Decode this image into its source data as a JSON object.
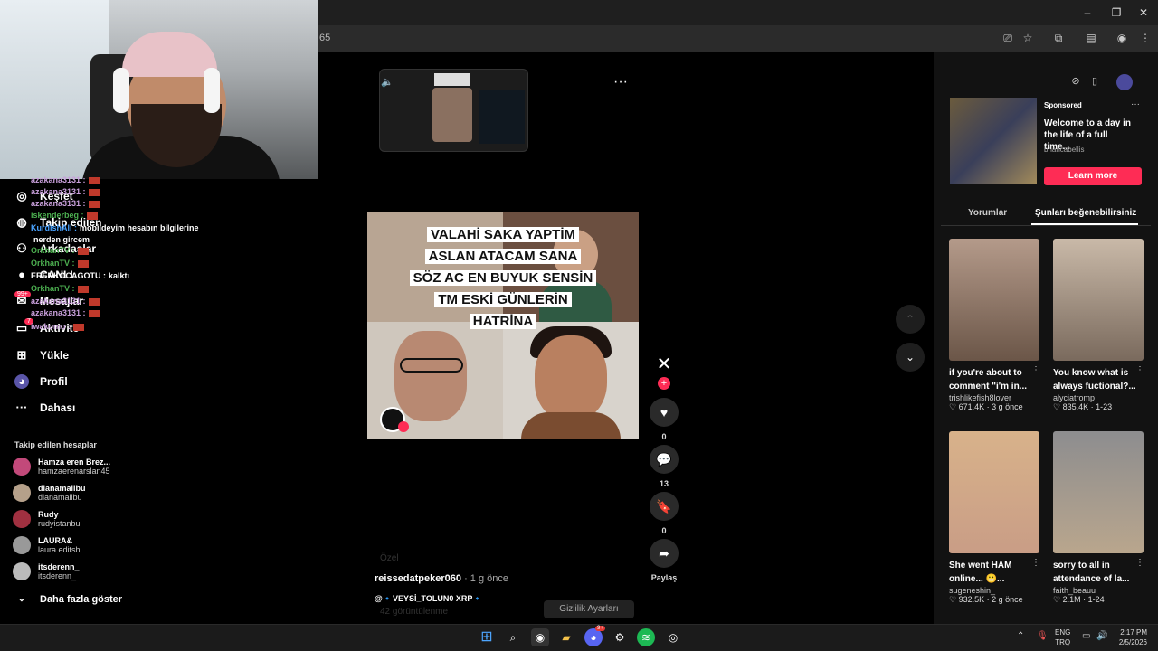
{
  "browser": {
    "address_fragment": "65"
  },
  "sidebar": {
    "nav": [
      {
        "label": "Keşfet",
        "icon": "compass-icon"
      },
      {
        "label": "Takip edilen",
        "icon": "following-icon"
      },
      {
        "label": "Arkadaşlar",
        "icon": "friends-icon"
      },
      {
        "label": "CANLI",
        "icon": "live-icon"
      },
      {
        "label": "Mesajlar",
        "icon": "messages-icon"
      },
      {
        "label": "Aktivite",
        "icon": "activity-icon"
      },
      {
        "label": "Yükle",
        "icon": "upload-icon"
      },
      {
        "label": "Profil",
        "icon": "profile-icon"
      },
      {
        "label": "Dahası",
        "icon": "more-icon"
      }
    ],
    "badges": {
      "messages": "99+",
      "activity": "7"
    },
    "chat_overlay": [
      {
        "user": "azakana3131 :",
        "text": "",
        "color": "#c9a0dc"
      },
      {
        "user": "azakana3131 :",
        "text": "",
        "color": "#c9a0dc"
      },
      {
        "user": "azakana3131 :",
        "text": "",
        "color": "#c9a0dc"
      },
      {
        "user": "iskenderbeg :",
        "text": "",
        "color": "#4caf50"
      },
      {
        "user": "KurdishAli :",
        "text": "mobildeyim hesabın bilgilerine",
        "color": "#4aa3ff"
      },
      {
        "user": "",
        "text": "nerden gircem",
        "color": "#fff"
      },
      {
        "user": "OrkhanTV :",
        "text": "",
        "color": "#4caf50"
      },
      {
        "user": "OrkhanTV :",
        "text": "",
        "color": "#4caf50"
      },
      {
        "user": "ERENKOCAGOTU :",
        "text": "kalktı",
        "color": "#fff"
      },
      {
        "user": "OrkhanTV :",
        "text": "",
        "color": "#4caf50"
      },
      {
        "user": "azakana3131 :",
        "text": "",
        "color": "#c9a0dc"
      },
      {
        "user": "azakana3131 :",
        "text": "",
        "color": "#c9a0dc"
      },
      {
        "user": "iwakomo :",
        "text": "",
        "color": "#c9a0dc"
      }
    ],
    "following_header": "Takip edilen hesaplar",
    "accounts": [
      {
        "name": "Hamza eren Brez...",
        "user": "hamzaerenarslan45"
      },
      {
        "name": "dianamalibu",
        "user": "dianamalibu"
      },
      {
        "name": "Rudy",
        "user": "rudyistanbul"
      },
      {
        "name": "LAURA&",
        "user": "laura.editsh"
      },
      {
        "name": "itsderenn_",
        "user": "itsderenn_"
      }
    ],
    "show_more": "Daha fazla göster"
  },
  "video": {
    "caption_lines": [
      "VALAHİ SAKA YAPTİM",
      "ASLAN ATACAM SANA",
      "SÖZ AC EN BUYUK SENSİN",
      "TM ESKİ GÜNLERİN",
      "HATRİNA"
    ],
    "author": "reissedatpeker060",
    "time": "· 1 g önce",
    "tags": "@🔹VEYSİ_TOLUN0 XRP🔹",
    "privacy_button": "Gizlilik Ayarları",
    "views": "42 görüntülenme",
    "private_label": "Özel"
  },
  "actions": {
    "likes": "0",
    "comments": "13",
    "saves": "0",
    "share_label": "Paylaş"
  },
  "ad": {
    "sponsored": "Sponsored",
    "title": "Welcome to a day in the life of a full time...",
    "user": "briancabellis",
    "cta": "Learn more"
  },
  "tabs": [
    "Yorumlar",
    "Şunları beğenebilirsiniz"
  ],
  "suggestions": [
    {
      "title": "if you're about to comment \"i'm in...",
      "user": "trishlikefish8lover",
      "meta": "♡ 671.4K · 3 g önce",
      "thumb": "#8a7566"
    },
    {
      "title": "You know what is always fuctional?...",
      "user": "alyciatromp",
      "meta": "♡ 835.4K · 1-23",
      "thumb": "#9a8c7e"
    },
    {
      "title": "She went HAM online... 😬...",
      "user": "sugeneshin_",
      "meta": "♡ 932.5K · 2 g önce",
      "thumb": "#b7a493"
    },
    {
      "title": "sorry to all in attendance of la...",
      "user": "faith_beauu",
      "meta": "♡ 2.1M · 1-24",
      "thumb": "#6e6a66"
    }
  ],
  "taskbar": {
    "lang": "ENG",
    "region": "TRQ",
    "time": "2:17 PM",
    "date": "2/5/2026",
    "discord_badge": "9+"
  }
}
